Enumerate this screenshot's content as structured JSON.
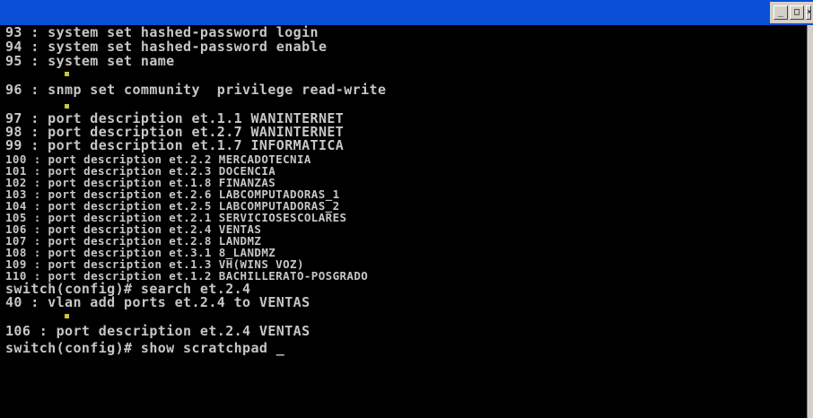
{
  "window": {
    "title": "",
    "buttons": [
      "minimize",
      "maximize",
      "close"
    ],
    "accent": "#0a4fd6",
    "text_color": "#c6c6c6"
  },
  "console": {
    "lines": [
      "93 : system set hashed-password login",
      "94 : system set hashed-password enable",
      "95 : system set name",
      "96 : snmp set community  privilege read-write",
      "97 : port description et.1.1 WANINTERNET",
      "98 : port description et.2.7 WANINTERNET",
      "99 : port description et.1.7 INFORMATICA",
      "100 : port description et.2.2 MERCADOTECNIA",
      "101 : port description et.2.3 DOCENCIA",
      "102 : port description et.1.8 FINANZAS",
      "103 : port description et.2.6 LABCOMPUTADORAS_1",
      "104 : port description et.2.5 LABCOMPUTADORAS_2",
      "105 : port description et.2.1 SERVICIOSESCOLARES",
      "106 : port description et.2.4 VENTAS",
      "107 : port description et.2.8 LANDMZ",
      "108 : port description et.3.1 8_LANDMZ",
      "109 : port description et.1.3 VH(WINS VOZ)",
      "110 : port description et.1.2 BACHILLERATO-POSGRADO",
      "switch(config)# search et.2.4",
      "40 : vlan add ports et.2.4 to VENTAS",
      "106 : port description et.2.4 VENTAS",
      "switch(config)# show scratchpad _"
    ]
  }
}
